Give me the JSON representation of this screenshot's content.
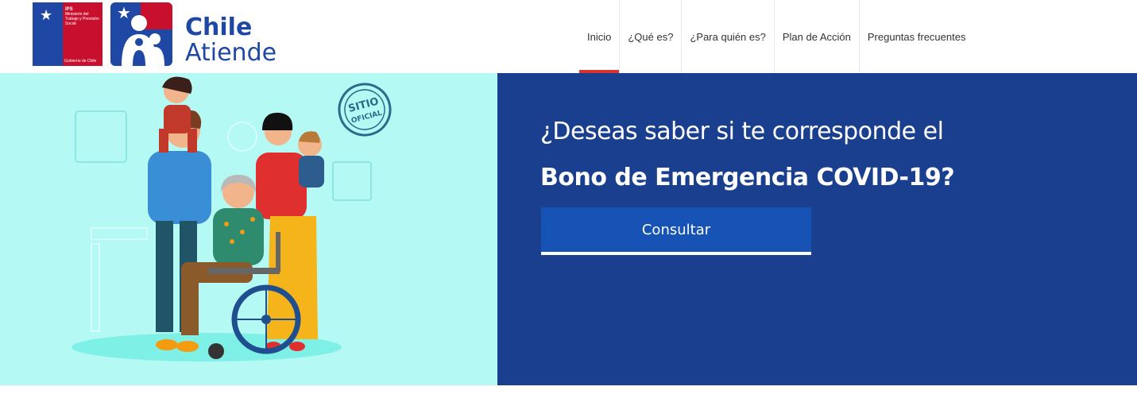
{
  "header": {
    "ips_logo": {
      "abbr": "IPS",
      "text": "Ministerio del Trabajo y Previsión Social",
      "footer": "Gobierno de Chile"
    },
    "brand": {
      "line1": "Chile",
      "line2": "Atiende"
    },
    "nav": [
      {
        "label": "Inicio",
        "active": true
      },
      {
        "label": "¿Qué es?"
      },
      {
        "label": "¿Para quién es?"
      },
      {
        "label": "Plan de Acción"
      },
      {
        "label": "Preguntas frecuentes"
      }
    ]
  },
  "hero": {
    "badge": {
      "line1": "SITIO",
      "line2": "OFICIAL"
    },
    "question_line1": "¿Deseas saber si te corresponde el",
    "question_line2": "Bono de Emergencia COVID-19?",
    "button_label": "Consultar"
  },
  "colors": {
    "brand_blue": "#1f47a4",
    "brand_red": "#c8102e",
    "hero_bg": "#b5f9f4",
    "panel_bg": "#1b3f8f",
    "button_bg": "#1653b5"
  }
}
